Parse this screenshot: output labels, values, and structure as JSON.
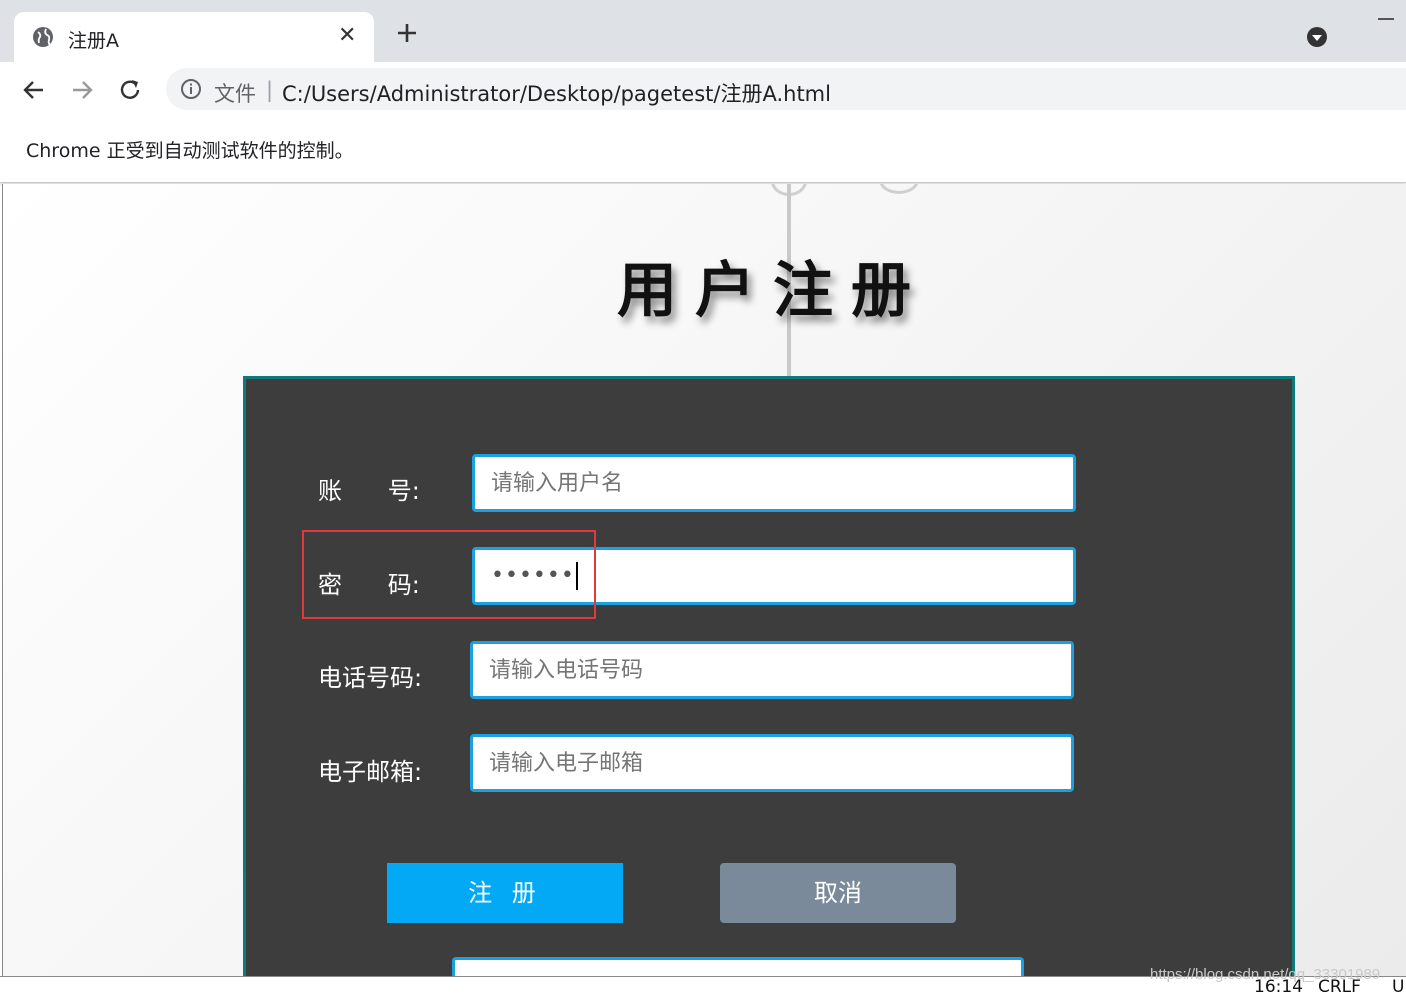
{
  "browser": {
    "tab": {
      "title": "注册A",
      "close_glyph": "✕"
    },
    "address_bar": {
      "scheme_label": "文件",
      "separator": "|",
      "url": "C:/Users/Administrator/Desktop/pagetest/注册A.html"
    },
    "infobar_text": "Chrome 正受到自动测试软件的控制。"
  },
  "page": {
    "title": "用户注册",
    "form": {
      "username": {
        "label": "账      号:",
        "placeholder": "请输入用户名",
        "value": ""
      },
      "password": {
        "label": "密      码:",
        "value_masked": "••••••"
      },
      "phone": {
        "label": "电话号码:",
        "placeholder": "请输入电话号码",
        "value": ""
      },
      "email": {
        "label": "电子邮箱:",
        "placeholder": "请输入电子邮箱",
        "value": ""
      }
    },
    "buttons": {
      "register": "注 册",
      "cancel": "取消"
    }
  },
  "status_bar": {
    "time": "16:14",
    "line_ending": "CRLF",
    "encoding": "U"
  },
  "watermark": "https://blog.csdn.net/qq_33301989",
  "colors": {
    "panel_bg": "#3d3d3d",
    "panel_border": "#0f7a78",
    "input_border": "#1ba0e0",
    "register_button": "#03a9f4",
    "cancel_button": "#7b8a9a",
    "highlight_box": "#e0393e"
  },
  "icons": {
    "tab_favicon": "globe-icon",
    "new_tab": "plus-icon",
    "tab_menu": "dropdown-circle-icon",
    "back": "arrow-left-icon",
    "forward": "arrow-right-icon",
    "reload": "reload-icon",
    "site_info": "info-icon"
  }
}
